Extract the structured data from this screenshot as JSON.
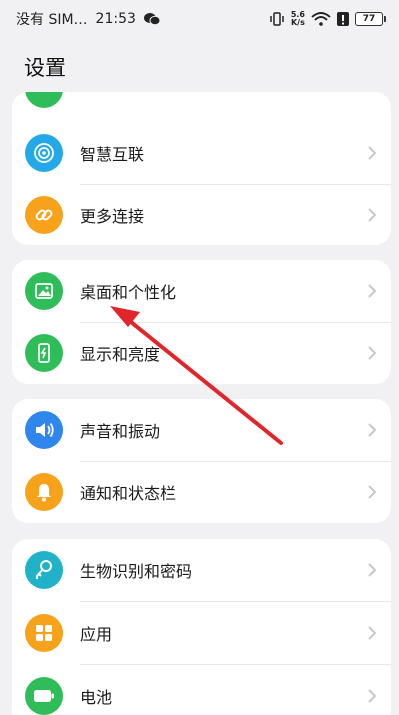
{
  "status_bar": {
    "carrier": "没有 SIM…",
    "time": "21:53",
    "net_speed_top": "5.6",
    "net_speed_bottom": "K/s",
    "battery": "77"
  },
  "page": {
    "title": "设置"
  },
  "cards": [
    {
      "items": [
        {
          "label": "智慧互联",
          "icon": "multi-device-icon",
          "color": "#23a9e8"
        },
        {
          "label": "更多连接",
          "icon": "link-icon",
          "color": "#f7a21b"
        }
      ]
    },
    {
      "items": [
        {
          "label": "桌面和个性化",
          "icon": "picture-icon",
          "color": "#2fbd59"
        },
        {
          "label": "显示和亮度",
          "icon": "brightness-icon",
          "color": "#2fbd59"
        }
      ]
    },
    {
      "items": [
        {
          "label": "声音和振动",
          "icon": "volume-icon",
          "color": "#2f87ee"
        },
        {
          "label": "通知和状态栏",
          "icon": "bell-icon",
          "color": "#f7a21b"
        }
      ]
    },
    {
      "items": [
        {
          "label": "生物识别和密码",
          "icon": "key-icon",
          "color": "#1fb2c9"
        },
        {
          "label": "应用",
          "icon": "apps-grid-icon",
          "color": "#f7a21b"
        },
        {
          "label": "电池",
          "icon": "battery-icon",
          "color": "#2fbd59"
        }
      ]
    }
  ],
  "annotation": {
    "color": "#e0262b"
  }
}
